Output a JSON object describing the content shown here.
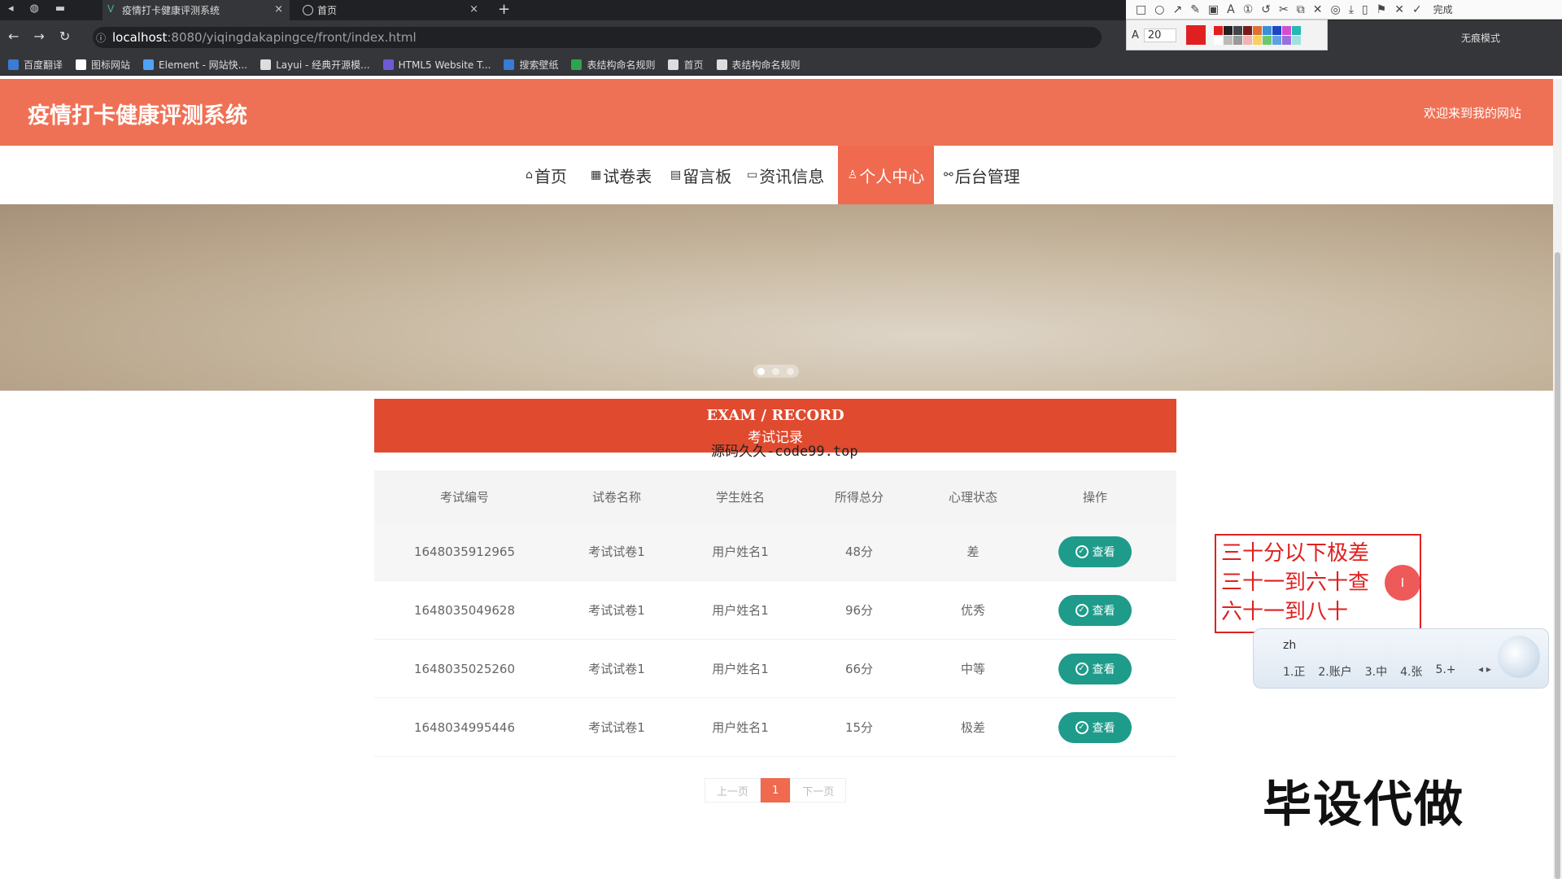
{
  "browser": {
    "tabs": [
      {
        "title": "疫情打卡健康评测系统",
        "active": true
      },
      {
        "title": "首页",
        "active": false
      }
    ],
    "url_host": "localhost",
    "url_path": ":8080/yiqingdakapingce/front/index.html",
    "incognito_label": "无痕模式",
    "bookmarks": [
      "百度翻译",
      "图标网站",
      "Element - 网站快...",
      "Layui - 经典开源模...",
      "HTML5 Website T...",
      "搜索壁纸",
      "表结构命名规则",
      "首页",
      "表结构命名规则"
    ]
  },
  "annot_toolbar": {
    "done_label": "完成",
    "font_size": "20",
    "colors": [
      "#e02020",
      "#222222",
      "#444444",
      "#7a1b1b",
      "#e07030",
      "#3a8fd8",
      "#1b47c8",
      "#d14ed1",
      "#26b7b7",
      "#ffffff",
      "#bbbbbb",
      "#999999",
      "#f3b2b2",
      "#f7d060",
      "#6cc86c",
      "#5fa0e8",
      "#9b6fe0",
      "#a0e0e0"
    ]
  },
  "site": {
    "title": "疫情打卡健康评测系统",
    "welcome": "欢迎来到我的网站",
    "nav": [
      {
        "label": "首页",
        "icon": "home-icon",
        "glyph": "⌂"
      },
      {
        "label": "试卷表",
        "icon": "grid-icon",
        "glyph": "▦"
      },
      {
        "label": "留言板",
        "icon": "board-icon",
        "glyph": "▤"
      },
      {
        "label": "资讯信息",
        "icon": "chat-icon",
        "glyph": "▭"
      },
      {
        "label": "个人中心",
        "icon": "user-icon",
        "glyph": "♙",
        "active": true
      },
      {
        "label": "后台管理",
        "icon": "link-icon",
        "glyph": "⚯"
      }
    ],
    "section_en": "EXAM / RECORD",
    "section_cn": "考试记录",
    "source_watermark": "源码久久-code99.top"
  },
  "table": {
    "headers": [
      "考试编号",
      "试卷名称",
      "学生姓名",
      "所得总分",
      "心理状态",
      "操作"
    ],
    "rows": [
      {
        "id": "1648035912965",
        "paper": "考试试卷1",
        "student": "用户姓名1",
        "score": "48分",
        "state": "差",
        "action": "查看"
      },
      {
        "id": "1648035049628",
        "paper": "考试试卷1",
        "student": "用户姓名1",
        "score": "96分",
        "state": "优秀",
        "action": "查看"
      },
      {
        "id": "1648035025260",
        "paper": "考试试卷1",
        "student": "用户姓名1",
        "score": "66分",
        "state": "中等",
        "action": "查看"
      },
      {
        "id": "1648034995446",
        "paper": "考试试卷1",
        "student": "用户姓名1",
        "score": "15分",
        "state": "极差",
        "action": "查看"
      }
    ]
  },
  "pager": {
    "prev": "上一页",
    "current": "1",
    "next": "下一页"
  },
  "annotation": {
    "lines": [
      "三十分以下极差",
      "三十一到六十查",
      "六十一到八十"
    ],
    "cursor_glyph": "I"
  },
  "ime": {
    "composition": "zh",
    "candidates": [
      "1.正",
      "2.账户",
      "3.中",
      "4.张",
      "5.+"
    ],
    "arrows": "◂ ▸"
  },
  "promo_text": "毕设代做",
  "colors": {
    "header": "#ef7155",
    "nav_active": "#ef6a4f",
    "section": "#e04a2e",
    "button": "#1e9b8b"
  }
}
